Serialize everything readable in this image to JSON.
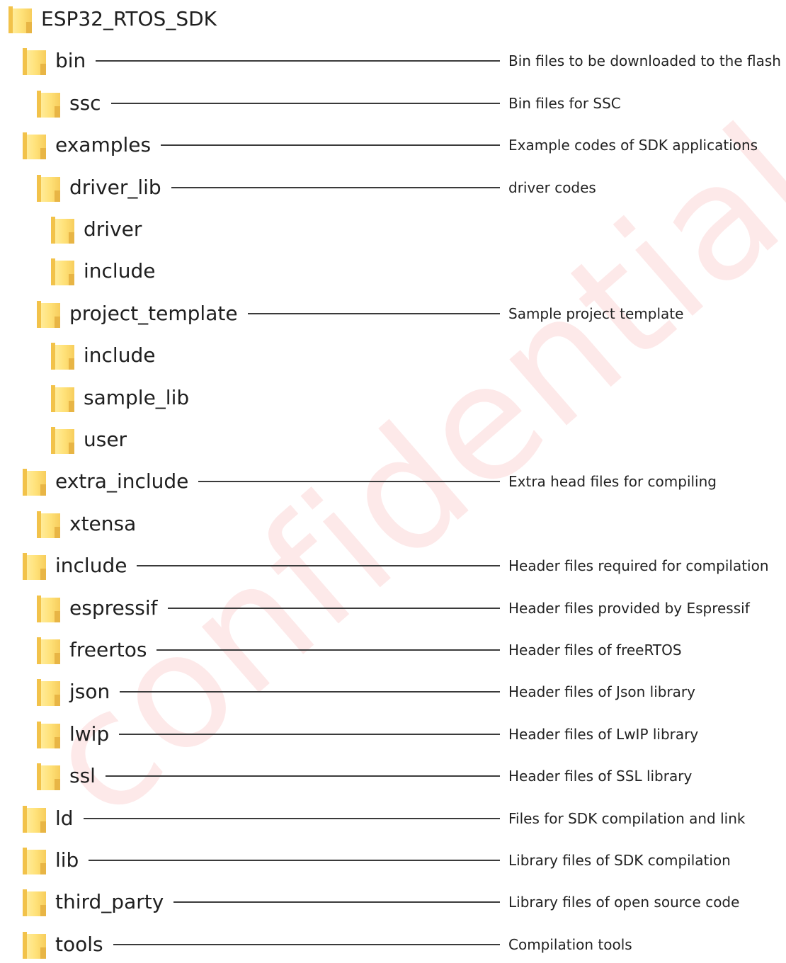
{
  "watermark": "confidential",
  "colors": {
    "folder_light": "#ffe27a",
    "folder_dark": "#e8b545",
    "line": "#3a3a3a",
    "watermark": "#ec2828"
  },
  "tree": [
    {
      "name": "ESP32_RTOS_SDK",
      "depth": 0,
      "desc": ""
    },
    {
      "name": "bin",
      "depth": 1,
      "desc": "Bin files to be downloaded to the flash"
    },
    {
      "name": "ssc",
      "depth": 2,
      "desc": "Bin files for SSC"
    },
    {
      "name": "examples",
      "depth": 1,
      "desc": "Example codes of SDK applications"
    },
    {
      "name": "driver_lib",
      "depth": 2,
      "desc": "driver codes"
    },
    {
      "name": "driver",
      "depth": 3,
      "desc": ""
    },
    {
      "name": "include",
      "depth": 3,
      "desc": ""
    },
    {
      "name": "project_template",
      "depth": 2,
      "desc": "Sample project template"
    },
    {
      "name": "include",
      "depth": 3,
      "desc": ""
    },
    {
      "name": "sample_lib",
      "depth": 3,
      "desc": ""
    },
    {
      "name": "user",
      "depth": 3,
      "desc": ""
    },
    {
      "name": "extra_include",
      "depth": 1,
      "desc": "Extra head files for compiling"
    },
    {
      "name": "xtensa",
      "depth": 2,
      "desc": ""
    },
    {
      "name": "include",
      "depth": 1,
      "desc": "Header files required for compilation"
    },
    {
      "name": "espressif",
      "depth": 2,
      "desc": "Header files provided by Espressif"
    },
    {
      "name": "freertos",
      "depth": 2,
      "desc": "Header files of freeRTOS"
    },
    {
      "name": "json",
      "depth": 2,
      "desc": "Header files of Json library"
    },
    {
      "name": "lwip",
      "depth": 2,
      "desc": "Header files of LwIP library"
    },
    {
      "name": "ssl",
      "depth": 2,
      "desc": "Header files of SSL library"
    },
    {
      "name": "ld",
      "depth": 1,
      "desc": "Files for SDK compilation and link"
    },
    {
      "name": "lib",
      "depth": 1,
      "desc": "Library files of SDK compilation"
    },
    {
      "name": "third_party",
      "depth": 1,
      "desc": "Library files of open source code"
    },
    {
      "name": "tools",
      "depth": 1,
      "desc": "Compilation tools"
    }
  ]
}
